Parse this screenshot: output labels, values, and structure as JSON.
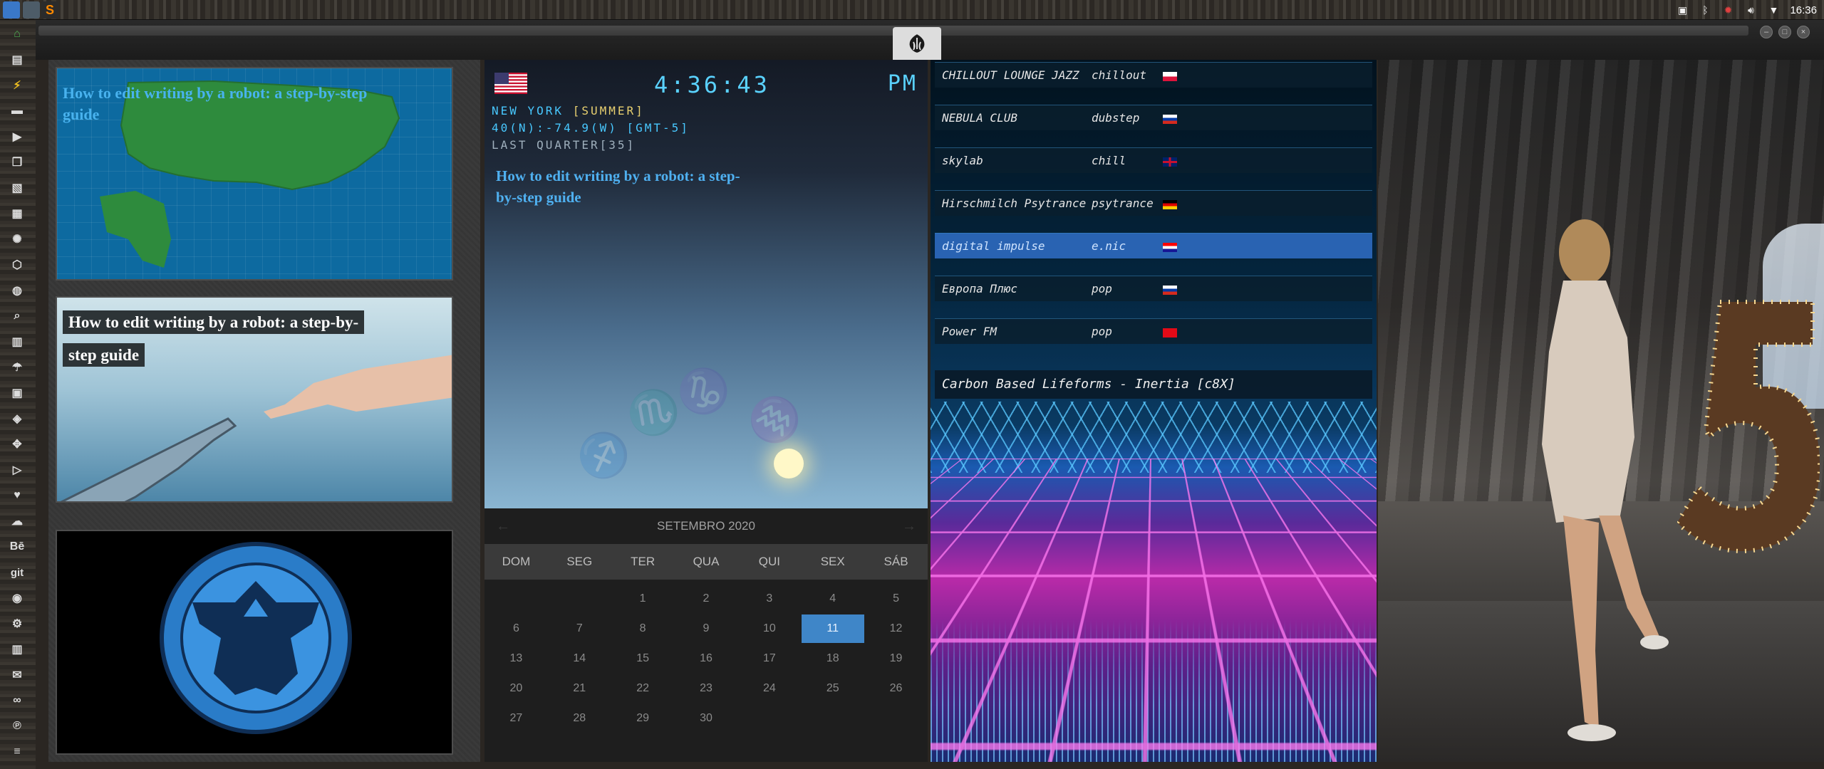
{
  "panel": {
    "clock": "16:36"
  },
  "window": {
    "close": "×",
    "minimize": "–",
    "maximize": "□"
  },
  "news": {
    "card1_headline": "How to edit writing by a robot: a step-by-step guide",
    "card2_headline": "How to edit writing by a robot: a step-by-step guide"
  },
  "clock_widget": {
    "time": "4:36:43",
    "ampm": "PM",
    "city": "NEW YORK ",
    "season": "[SUMMER]",
    "coords": "40(N):-74.9(W) [GMT-5]",
    "moon": "LAST QUARTER[35]",
    "headline": "How to edit writing by a robot: a step-by-step guide"
  },
  "calendar": {
    "month": "SETEMBRO 2020",
    "prev": "←",
    "next": "→",
    "weekdays": [
      "DOM",
      "SEG",
      "TER",
      "QUA",
      "QUI",
      "SEX",
      "SÁB"
    ],
    "days": [
      "",
      "",
      "1",
      "2",
      "3",
      "4",
      "5",
      "6",
      "7",
      "8",
      "9",
      "10",
      "11",
      "12",
      "13",
      "14",
      "15",
      "16",
      "17",
      "18",
      "19",
      "20",
      "21",
      "22",
      "23",
      "24",
      "25",
      "26",
      "27",
      "28",
      "29",
      "30"
    ],
    "today": "11"
  },
  "radio": {
    "stations": [
      {
        "name": "CHILLOUT LOUNGE JAZZ",
        "genre": "chillout",
        "flag": "poland"
      },
      {
        "name": "NEBULA CLUB",
        "genre": "dubstep",
        "flag": "russia"
      },
      {
        "name": "skylab",
        "genre": "chill",
        "flag": "uk"
      },
      {
        "name": "Hirschmilch Psytrance",
        "genre": "psytrance",
        "flag": "germany"
      },
      {
        "name": "digital impulse",
        "genre": "e.nic",
        "flag": "croatia"
      },
      {
        "name": "Европа Плюс",
        "genre": "pop",
        "flag": "russia"
      },
      {
        "name": "Power FM",
        "genre": "pop",
        "flag": "turkey"
      }
    ],
    "active_index": 4,
    "now_playing": "Carbon Based Lifeforms - Inertia [c8X]"
  },
  "dock": {
    "items": [
      "home-icon",
      "document-icon",
      "bolt-icon",
      "archive-icon",
      "play-icon",
      "files-icon",
      "image-icon",
      "news-icon",
      "rebel-icon",
      "hex-icon",
      "globe-icon",
      "search-icon",
      "map-icon",
      "umbrella-icon",
      "contacts-icon",
      "tag-icon",
      "expand-icon",
      "youtube-icon",
      "heart-icon",
      "cloud-icon",
      "behance-icon",
      "git-icon",
      "github-icon",
      "bicycle-icon",
      "map2-icon",
      "mail-icon",
      "link-icon",
      "pinterest-icon",
      "list-icon"
    ],
    "behance_label": "Bē",
    "git_label": "git"
  },
  "colors": {
    "accent": "#5ad2ff",
    "today": "#3f86c8",
    "active_station": "#306ec8"
  }
}
